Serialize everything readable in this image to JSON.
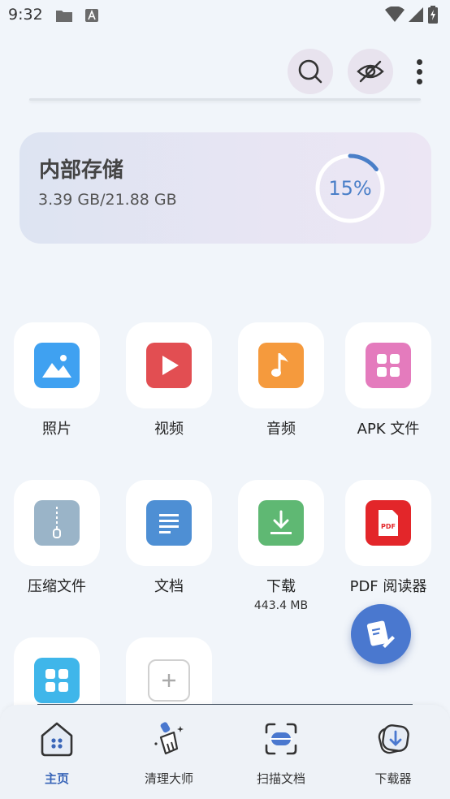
{
  "status_bar": {
    "time": "9:32",
    "icons": [
      "folder-icon",
      "font-a-icon",
      "wifi-icon",
      "signal-icon",
      "battery-icon"
    ]
  },
  "toolbar": {
    "icons": [
      "search-icon",
      "eye-off-icon",
      "more-vert-icon"
    ]
  },
  "storage": {
    "title": "内部存储",
    "size": "3.39 GB/21.88 GB",
    "percent_label": "15%",
    "percent": 0.15
  },
  "grid": [
    {
      "label": "照片",
      "icon": "photo-icon",
      "color": "#3fa1f1"
    },
    {
      "label": "视频",
      "icon": "video-play-icon",
      "color": "#e24e52"
    },
    {
      "label": "音频",
      "icon": "music-note-icon",
      "color": "#f59a3d"
    },
    {
      "label": "APK 文件",
      "icon": "apk-grid-icon",
      "color": "#e47bbd"
    },
    {
      "label": "压缩文件",
      "icon": "zip-archive-icon",
      "color": "#9ab4c8"
    },
    {
      "label": "文档",
      "icon": "document-icon",
      "color": "#4e8fd4"
    },
    {
      "label": "下载",
      "sub": "443.4 MB",
      "icon": "download-icon",
      "color": "#5fb873"
    },
    {
      "label": "PDF 阅读器",
      "icon": "pdf-icon",
      "color": "#e3262a"
    },
    {
      "icon": "apps-grid-icon",
      "color": "#3fb6ea"
    },
    {
      "icon": "add-icon",
      "color": "#ffffff"
    }
  ],
  "fab": {
    "icon": "edit-note-icon",
    "color": "#4a78cf"
  },
  "bottom_nav": [
    {
      "label": "主页",
      "icon": "home-icon",
      "active": true
    },
    {
      "label": "清理大师",
      "icon": "broom-icon",
      "active": false
    },
    {
      "label": "扫描文档",
      "icon": "scan-icon",
      "active": false
    },
    {
      "label": "下载器",
      "icon": "downloader-icon",
      "active": false
    }
  ],
  "colors": {
    "accent": "#4a78cf",
    "background": "#f1f5fa"
  }
}
